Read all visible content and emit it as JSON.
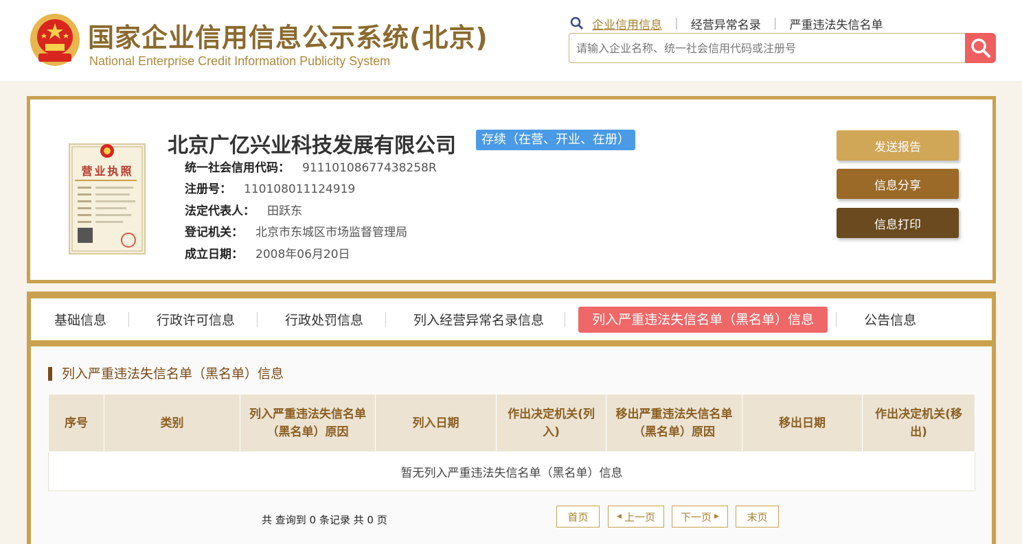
{
  "header": {
    "title": "国家企业信用信息公示系统(北京)",
    "subtitle": "National Enterprise Credit Information Publicity System",
    "nav": [
      "企业信用信息",
      "经营异常名录",
      "严重违法失信名单"
    ],
    "search_placeholder": "请输入企业名称、统一社会信用代码或注册号"
  },
  "company": {
    "name": "北京广亿兴业科技发展有限公司",
    "status": "存续（在营、开业、在册）",
    "fields": [
      {
        "label": "统一社会信用代码：",
        "value": "91110108677438258R"
      },
      {
        "label": "注册号：",
        "value": "110108011124919"
      },
      {
        "label": "法定代表人：",
        "value": "田跃东"
      },
      {
        "label": "登记机关：",
        "value": "北京市东城区市场监督管理局"
      },
      {
        "label": "成立日期：",
        "value": "2008年06月20日"
      }
    ],
    "license_label": "营业执照",
    "buttons": {
      "send_report": "发送报告",
      "share": "信息分享",
      "print": "信息打印"
    }
  },
  "tabs": [
    "基础信息",
    "行政许可信息",
    "行政处罚信息",
    "列入经营异常名录信息",
    "列入严重违法失信名单（黑名单）信息",
    "公告信息"
  ],
  "section": {
    "title": "列入严重违法失信名单（黑名单）信息",
    "columns": [
      "序号",
      "类别",
      "列入严重违法失信名单（黑名单）原因",
      "列入日期",
      "作出决定机关(列入)",
      "移出严重违法失信名单（黑名单）原因",
      "移出日期",
      "作出决定机关(移出)"
    ],
    "empty_text": "暂无列入严重违法失信名单（黑名单）信息"
  },
  "pagination": {
    "summary": "共 查询到 0 条记录 共 0 页",
    "first": "首页",
    "prev": "上一页",
    "next": "下一页",
    "last": "末页"
  },
  "colors": {
    "accent": "#c9a14f",
    "active_tab": "#ef6767",
    "status_badge": "#4a9ae6"
  }
}
